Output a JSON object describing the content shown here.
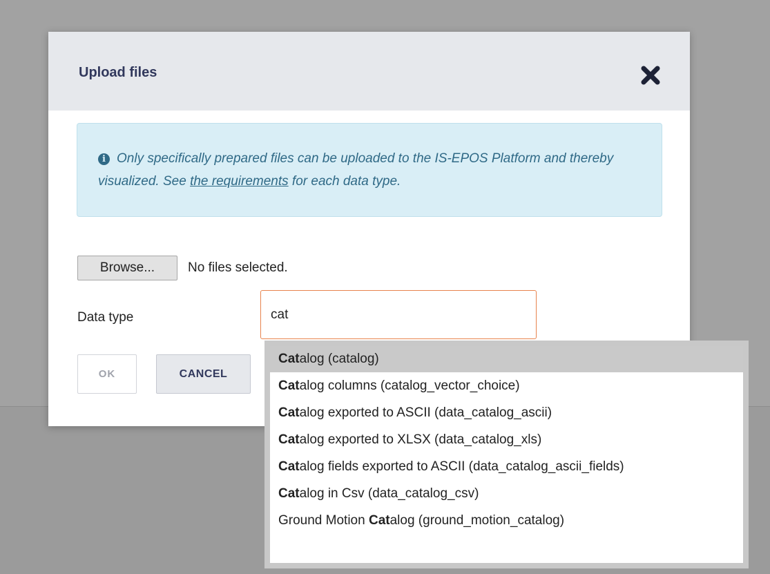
{
  "dialog": {
    "title": "Upload files",
    "close_icon": "close-x-icon"
  },
  "info": {
    "icon": "info-circle-icon",
    "text_before": "Only specifically prepared files can be uploaded to the IS-EPOS Platform and thereby visualized. See ",
    "link_text": "the requirements",
    "text_after": " for each data type."
  },
  "file": {
    "browse_label": "Browse...",
    "status": "No files selected."
  },
  "data_type": {
    "label": "Data type",
    "value": "cat"
  },
  "buttons": {
    "ok_label": "OK",
    "cancel_label": "CANCEL"
  },
  "autocomplete": {
    "items": [
      {
        "match": "Cat",
        "before": "",
        "after": "alog (catalog)",
        "active": true
      },
      {
        "match": "Cat",
        "before": "",
        "after": "alog columns (catalog_vector_choice)",
        "active": false
      },
      {
        "match": "Cat",
        "before": "",
        "after": "alog exported to ASCII (data_catalog_ascii)",
        "active": false
      },
      {
        "match": "Cat",
        "before": "",
        "after": "alog exported to XLSX (data_catalog_xls)",
        "active": false
      },
      {
        "match": "Cat",
        "before": "",
        "after": "alog fields exported to ASCII (data_catalog_ascii_fields)",
        "active": false
      },
      {
        "match": "Cat",
        "before": "",
        "after": "alog in Csv (data_catalog_csv)",
        "active": false
      },
      {
        "match": "Cat",
        "before": "Ground Motion ",
        "after": "alog (ground_motion_catalog)",
        "active": false
      }
    ]
  },
  "colors": {
    "accent": "#e8834c",
    "title": "#31385c",
    "info_bg": "#d9eef6",
    "info_text": "#2f6986"
  }
}
